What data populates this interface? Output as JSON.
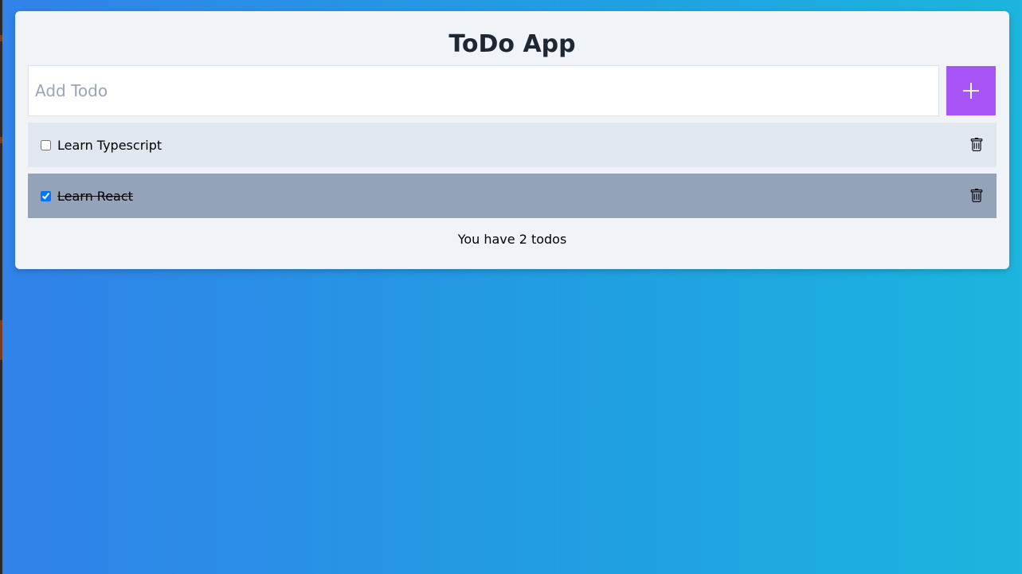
{
  "app": {
    "title": "ToDo App"
  },
  "add_todo": {
    "placeholder": "Add Todo",
    "value": "",
    "button_icon": "plus-icon",
    "button_color": "#a855f7"
  },
  "todos": [
    {
      "label": "Learn Typescript",
      "completed": false,
      "delete_icon": "trash-icon"
    },
    {
      "label": "Learn React",
      "completed": true,
      "delete_icon": "trash-icon"
    }
  ],
  "footer": {
    "count_text": "You have 2 todos"
  },
  "colors": {
    "card_background": "#f0f4f8",
    "pending_row": "#e1e7ef",
    "completed_row": "#94a3b8",
    "background_gradient_start": "#3182e9",
    "background_gradient_end": "#1bb5de"
  }
}
